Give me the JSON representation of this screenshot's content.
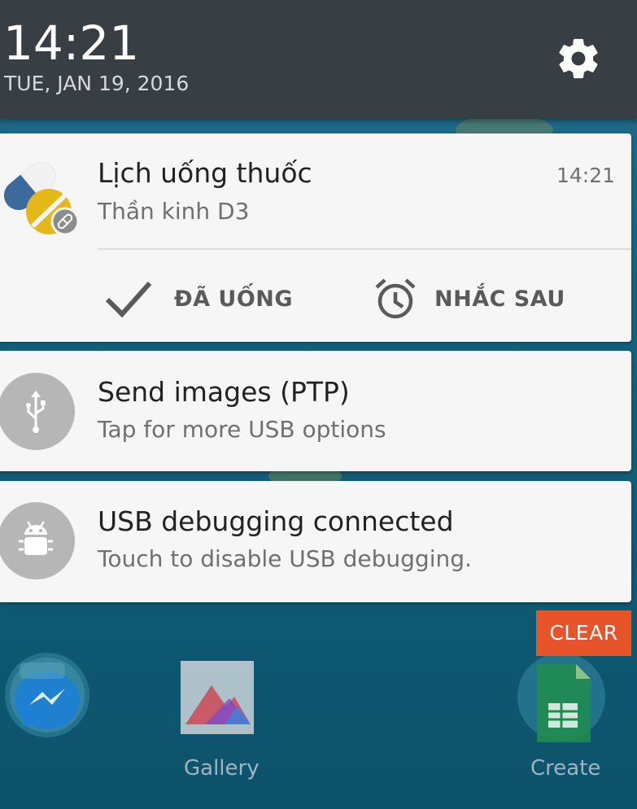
{
  "header": {
    "time": "14:21",
    "date": "TUE, JAN 19, 2016"
  },
  "notifications": [
    {
      "title": "Lịch uống thuốc",
      "subtitle": "Thần kinh D3",
      "time": "14:21",
      "actions": [
        {
          "label": "ĐÃ UỐNG",
          "icon": "check-icon"
        },
        {
          "label": "NHẮC SAU",
          "icon": "alarm-clock-icon"
        }
      ],
      "icon": "pill-icon"
    },
    {
      "title": "Send images (PTP)",
      "subtitle": "Tap for more USB options",
      "icon": "usb-icon"
    },
    {
      "title": "USB debugging connected",
      "subtitle": "Touch to disable USB debugging.",
      "icon": "android-bug-icon"
    }
  ],
  "clear_label": "CLEAR",
  "dock": {
    "apps": [
      {
        "label": "",
        "icon": "messenger-icon"
      },
      {
        "label": "Gallery",
        "icon": "gallery-icon"
      },
      {
        "label": "Create",
        "icon": "sheets-icon"
      }
    ]
  },
  "colors": {
    "header_bg": "#373e44",
    "card_bg": "#f6f6f6",
    "clear_bg": "#e8542a",
    "pill_blue": "#3d6a9c",
    "pill_yellow": "#e4b81b"
  }
}
